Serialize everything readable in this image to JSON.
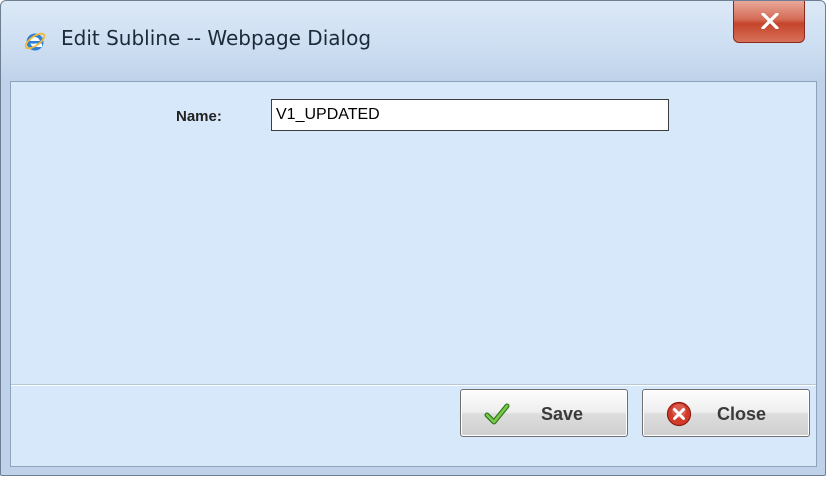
{
  "window": {
    "title": "Edit Subline -- Webpage Dialog",
    "title_icon": "ie-icon",
    "close_icon": "close-icon"
  },
  "form": {
    "name_label": "Name:",
    "name_value": "V1_UPDATED"
  },
  "buttons": {
    "save_label": "Save",
    "save_icon": "checkmark-icon",
    "close_label": "Close",
    "close_icon": "close-circle-icon"
  },
  "colors": {
    "client_bg": "#d8e8fb",
    "close_button": "#c4442b",
    "checkmark": "#4a9a2a",
    "close_circle": "#d23a2a"
  }
}
